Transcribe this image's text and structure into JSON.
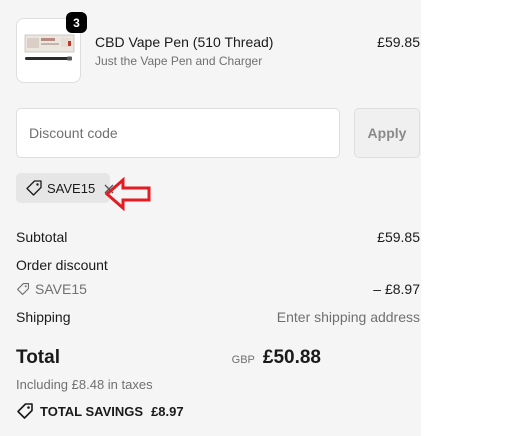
{
  "line_item": {
    "quantity": "3",
    "title": "CBD Vape Pen (510 Thread)",
    "subtitle": "Just the Vape Pen and Charger",
    "price": "£59.85"
  },
  "discount": {
    "placeholder": "Discount code",
    "apply_label": "Apply",
    "applied_code": "SAVE15"
  },
  "summary": {
    "subtotal_label": "Subtotal",
    "subtotal_value": "£59.85",
    "order_discount_label": "Order discount",
    "discount_code": "SAVE15",
    "discount_value": "– £8.97",
    "shipping_label": "Shipping",
    "shipping_value": "Enter shipping address",
    "total_label": "Total",
    "currency": "GBP",
    "total_value": "£50.88",
    "tax_note": "Including £8.48 in taxes",
    "savings_label": "TOTAL SAVINGS",
    "savings_value": "£8.97"
  },
  "colors": {
    "annotation_arrow": "#e31b23",
    "panel_bg": "#f5f5f5"
  }
}
